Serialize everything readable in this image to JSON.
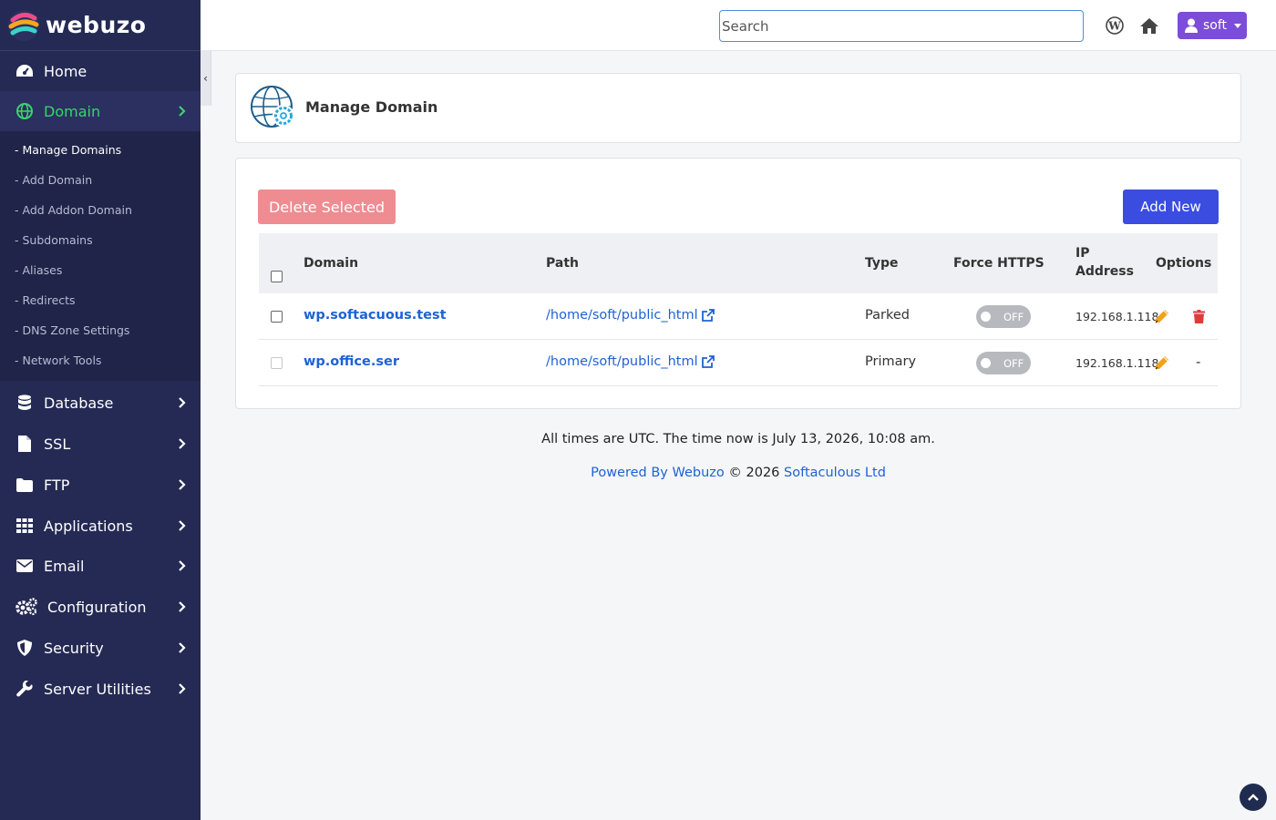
{
  "app": {
    "name": "webuzo"
  },
  "sidebar": {
    "collapse_glyph": "‹",
    "items": [
      {
        "label": "Home",
        "icon": "dashboard-icon"
      },
      {
        "label": "Domain",
        "icon": "globe-icon",
        "active": true
      },
      {
        "label": "Database",
        "icon": "database-icon"
      },
      {
        "label": "SSL",
        "icon": "file-icon"
      },
      {
        "label": "FTP",
        "icon": "folder-icon"
      },
      {
        "label": "Applications",
        "icon": "grid-icon"
      },
      {
        "label": "Email",
        "icon": "envelope-icon"
      },
      {
        "label": "Configuration",
        "icon": "cogs-icon"
      },
      {
        "label": "Security",
        "icon": "shield-icon"
      },
      {
        "label": "Server Utilities",
        "icon": "wrench-icon"
      }
    ],
    "domain_submenu": [
      "- Manage Domains",
      "- Add Domain",
      "- Add Addon Domain",
      "- Subdomains",
      "- Aliases",
      "- Redirects",
      "- DNS Zone Settings",
      "- Network Tools"
    ]
  },
  "header": {
    "search_placeholder": "Search",
    "user_label": "soft",
    "accent_color": "#7c4dd9"
  },
  "page": {
    "title": "Manage Domain",
    "delete_label": "Delete Selected",
    "add_label": "Add New",
    "columns": {
      "domain": "Domain",
      "path": "Path",
      "type": "Type",
      "force_https": "Force HTTPS",
      "ip_line1": "IP",
      "ip_line2": "Address",
      "options": "Options"
    },
    "rows": [
      {
        "domain": "wp.softacuous.test",
        "path": "/home/soft/public_html",
        "type": "Parked",
        "https": "OFF",
        "ip": "192.168.1.118",
        "deletable": true
      },
      {
        "domain": "wp.office.ser",
        "path": "/home/soft/public_html",
        "type": "Primary",
        "https": "OFF",
        "ip": "192.168.1.118",
        "deletable": false,
        "no_delete_text": "-"
      }
    ]
  },
  "footer": {
    "time_text": "All times are UTC. The time now is July 13, 2026, 10:08 am.",
    "powered_link": "Powered By Webuzo",
    "copyright": "© 2026",
    "company_link": "Softaculous Ltd"
  }
}
